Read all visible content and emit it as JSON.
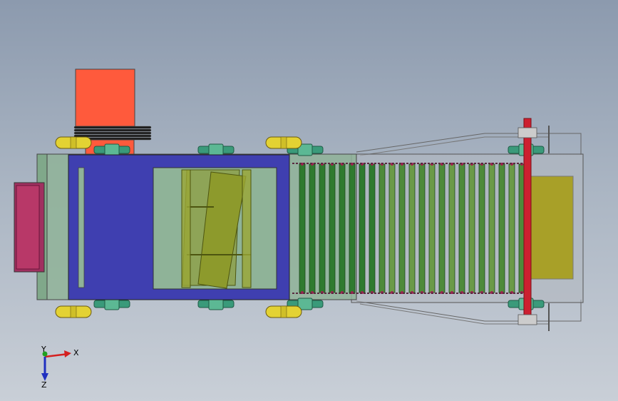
{
  "view": {
    "background_top": "#8c9aae",
    "background_bottom": "#c9cfd7"
  },
  "triad": {
    "x_label": "X",
    "y_label": "Y",
    "z_label": "Z",
    "x_color": "#d42020",
    "y_color": "#20a020",
    "z_color": "#2030c0"
  },
  "colors": {
    "motor": "#ff5a3c",
    "frame_cover": "#3f3fb0",
    "wheel": "#e3d233",
    "sprocket": "#3a9a7a",
    "plate": "#a03060",
    "slat_green": "#2f7a2f",
    "rail_red": "#cc2030",
    "hopper_olive": "#8d9a2c",
    "tray_yellow": "#a8a028"
  }
}
